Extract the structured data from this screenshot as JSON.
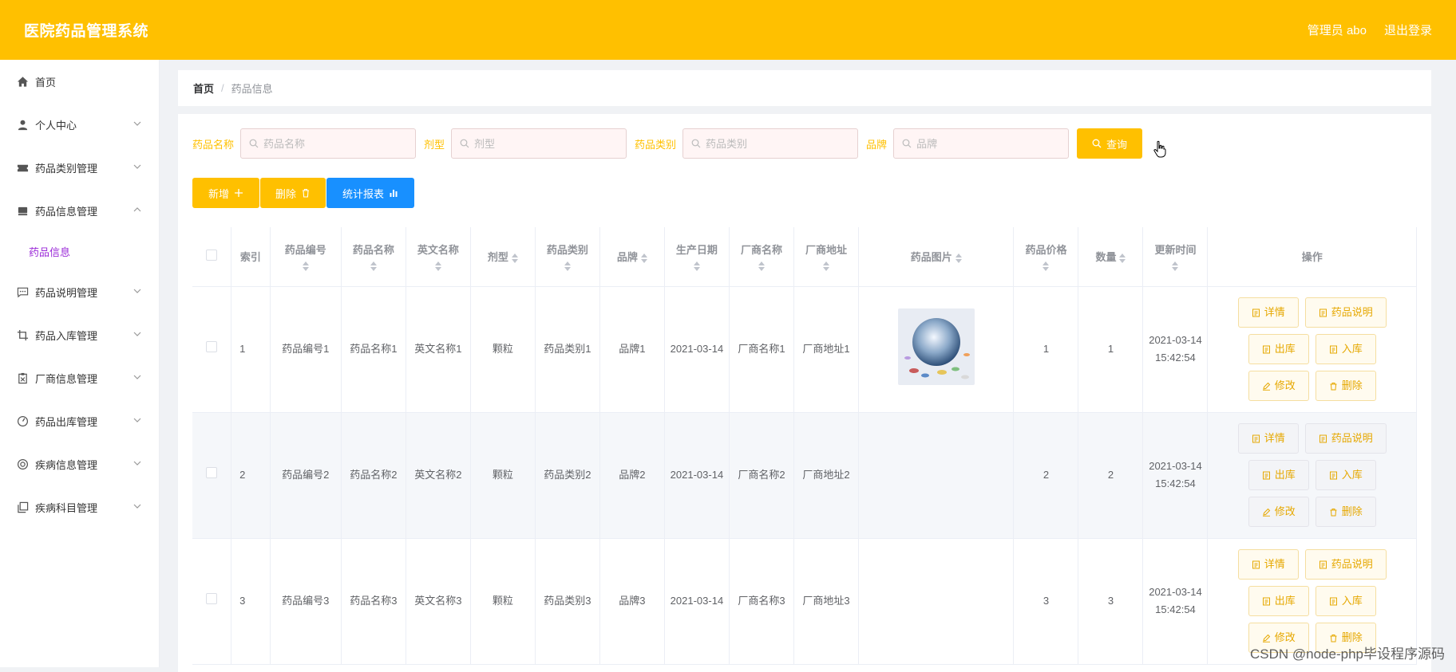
{
  "header": {
    "title": "医院药品管理系统",
    "admin_label": "管理员 abo",
    "logout_label": "退出登录"
  },
  "sidebar": {
    "items": [
      {
        "label": "首页",
        "icon": "home-icon"
      },
      {
        "label": "个人中心",
        "icon": "user-icon"
      },
      {
        "label": "药品类别管理",
        "icon": "ticket-icon"
      },
      {
        "label": "药品信息管理",
        "icon": "drawer-icon",
        "expanded": true
      },
      {
        "label": "药品说明管理",
        "icon": "chat-icon"
      },
      {
        "label": "药品入库管理",
        "icon": "crop-icon"
      },
      {
        "label": "厂商信息管理",
        "icon": "clipboard-icon"
      },
      {
        "label": "药品出库管理",
        "icon": "gauge-icon"
      },
      {
        "label": "疾病信息管理",
        "icon": "lifebuoy-icon"
      },
      {
        "label": "疾病科目管理",
        "icon": "copy-icon"
      }
    ],
    "sub_item": "药品信息"
  },
  "breadcrumb": {
    "home": "首页",
    "separator": "/",
    "current": "药品信息"
  },
  "search": {
    "fields": [
      {
        "label": "药品名称",
        "placeholder": "药品名称"
      },
      {
        "label": "剂型",
        "placeholder": "剂型"
      },
      {
        "label": "药品类别",
        "placeholder": "药品类别"
      },
      {
        "label": "品牌",
        "placeholder": "品牌"
      }
    ],
    "button": "查询"
  },
  "actions": {
    "add": "新增",
    "delete": "删除",
    "report": "统计报表"
  },
  "table": {
    "columns": [
      "索引",
      "药品编号",
      "药品名称",
      "英文名称",
      "剂型",
      "药品类别",
      "品牌",
      "生产日期",
      "厂商名称",
      "厂商地址",
      "药品图片",
      "药品价格",
      "数量",
      "更新时间",
      "操作"
    ],
    "rows": [
      {
        "index": "1",
        "code": "药品编号1",
        "name": "药品名称1",
        "english": "英文名称1",
        "form": "颗粒",
        "category": "药品类别1",
        "brand": "品牌1",
        "date": "2021-03-14",
        "maker": "厂商名称1",
        "address": "厂商地址1",
        "price": "1",
        "qty": "1",
        "updated": "2021-03-14 15:42:54",
        "has_image": true
      },
      {
        "index": "2",
        "code": "药品编号2",
        "name": "药品名称2",
        "english": "英文名称2",
        "form": "颗粒",
        "category": "药品类别2",
        "brand": "品牌2",
        "date": "2021-03-14",
        "maker": "厂商名称2",
        "address": "厂商地址2",
        "price": "2",
        "qty": "2",
        "updated": "2021-03-14 15:42:54",
        "has_image": false
      },
      {
        "index": "3",
        "code": "药品编号3",
        "name": "药品名称3",
        "english": "英文名称3",
        "form": "颗粒",
        "category": "药品类别3",
        "brand": "品牌3",
        "date": "2021-03-14",
        "maker": "厂商名称3",
        "address": "厂商地址3",
        "price": "3",
        "qty": "3",
        "updated": "2021-03-14 15:42:54",
        "has_image": false
      }
    ],
    "op_labels": {
      "detail": "详情",
      "desc": "药品说明",
      "out": "出库",
      "in": "入库",
      "edit": "修改",
      "del": "删除"
    }
  },
  "watermark": "CSDN @node-php毕设程序源码",
  "colors": {
    "accent": "#ffc000",
    "blue": "#1890ff",
    "sub_active": "#9b2bd8"
  }
}
